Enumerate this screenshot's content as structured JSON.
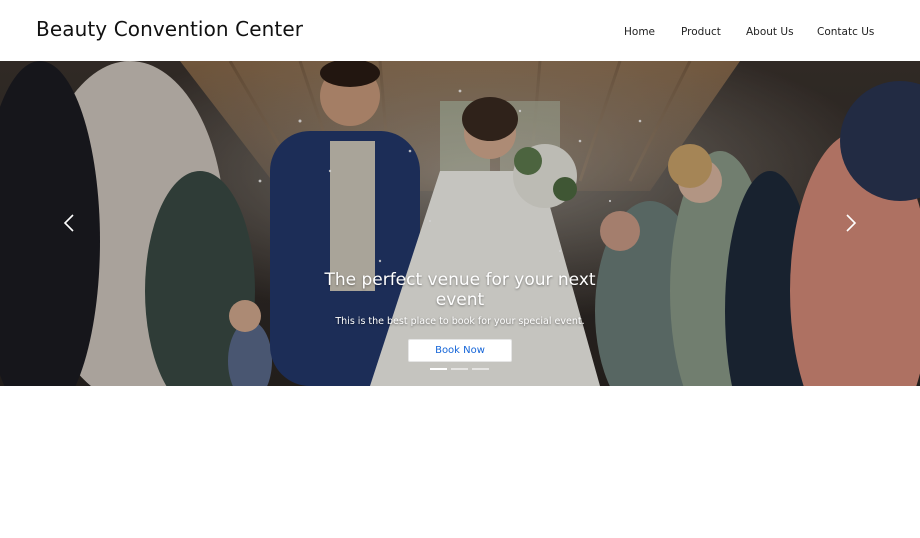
{
  "navbar": {
    "brand": "Beauty Convention Center",
    "links": [
      {
        "label": "Home"
      },
      {
        "label": "Product"
      },
      {
        "label": "About Us"
      },
      {
        "label": "Contatc Us"
      }
    ]
  },
  "hero": {
    "title": "The perfect venue for your next event",
    "subtitle": "This is the best place to book for your special event.",
    "button_label": "Book Now",
    "prev_icon": "chevron-left-icon",
    "next_icon": "chevron-right-icon",
    "slide_count": 3,
    "active_slide": 1
  },
  "colors": {
    "button_text": "#1565d8",
    "page_bg": "#ffffff"
  }
}
